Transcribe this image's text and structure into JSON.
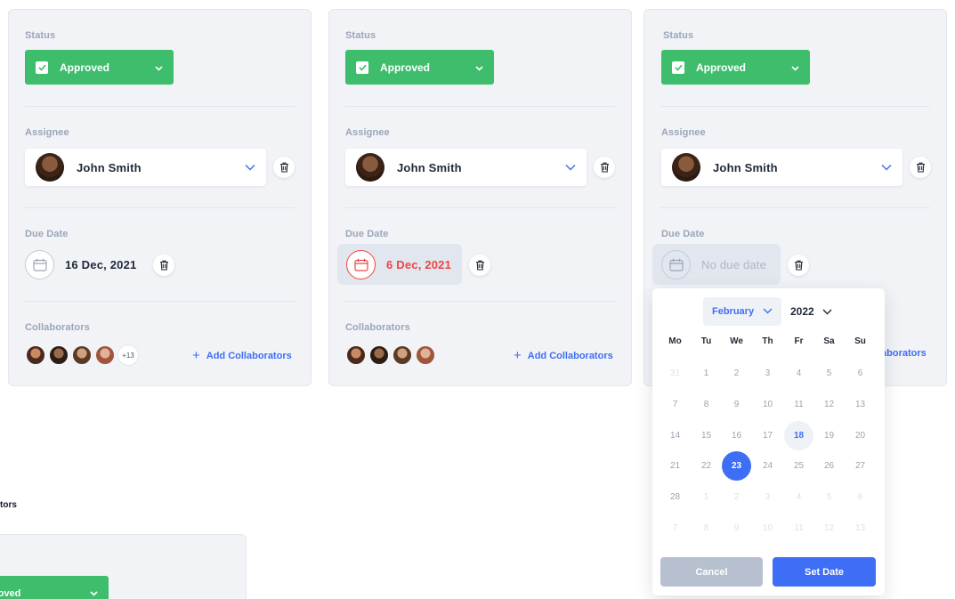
{
  "colors": {
    "accent": "#3e6ef5",
    "approved": "#3ebd6d",
    "overdue": "#ef4444",
    "muted": "#9aa6b8"
  },
  "cards": [
    {
      "status_label": "Status",
      "status_value": "Approved",
      "assignee_label": "Assignee",
      "assignee_name": "John Smith",
      "due_label": "Due Date",
      "due_value": "16 Dec, 2021",
      "collab_label": "Collaborators",
      "collab_more": "+13",
      "add_collab": "Add Collaborators"
    },
    {
      "status_label": "Status",
      "status_value": "Approved",
      "assignee_label": "Assignee",
      "assignee_name": "John Smith",
      "due_label": "Due Date",
      "due_value": "6 Dec, 2021",
      "collab_label": "Collaborators",
      "add_collab": "Add Collaborators"
    },
    {
      "status_label": "Status",
      "status_value": "Approved",
      "assignee_label": "Assignee",
      "assignee_name": "John Smith",
      "due_label": "Due Date",
      "due_value": "No due date",
      "add_collab_partial": "laborators"
    }
  ],
  "bottom": {
    "label_partial": "tors",
    "status_partial": "pproved"
  },
  "picker": {
    "month": "February",
    "year": "2022",
    "weekdays": [
      "Mo",
      "Tu",
      "We",
      "Th",
      "Fr",
      "Sa",
      "Su"
    ],
    "weeks": [
      [
        "31",
        "1",
        "2",
        "3",
        "4",
        "5",
        "6"
      ],
      [
        "7",
        "8",
        "9",
        "10",
        "11",
        "12",
        "13"
      ],
      [
        "14",
        "15",
        "16",
        "17",
        "18",
        "19",
        "20"
      ],
      [
        "21",
        "22",
        "23",
        "24",
        "25",
        "26",
        "27"
      ],
      [
        "28",
        "1",
        "2",
        "3",
        "4",
        "5",
        "6"
      ],
      [
        "7",
        "8",
        "9",
        "10",
        "11",
        "12",
        "13"
      ]
    ],
    "today": "18",
    "selected": "23",
    "cancel_label": "Cancel",
    "set_label": "Set Date"
  }
}
